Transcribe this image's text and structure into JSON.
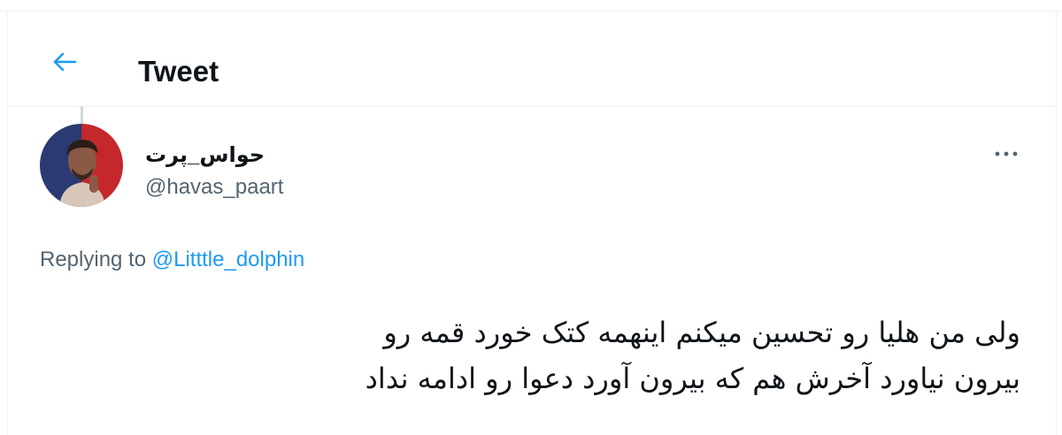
{
  "header": {
    "title": "Tweet",
    "back_icon": "arrow-left-icon"
  },
  "tweet": {
    "author": {
      "display_name": "حواس_پرت",
      "username": "@havas_paart",
      "avatar_icon": "avatar-photo"
    },
    "more_icon": "more-horizontal-icon",
    "reply": {
      "prefix": "Replying to",
      "mention": "@Litttle_dolphin"
    },
    "text_lines": [
      "ولی من هلیا رو تحسین میکنم اینهمه کتک خورد قمه رو",
      "بیرون نیاورد آخرش هم که بیرون آورد دعوا رو ادامه نداد"
    ]
  },
  "colors": {
    "accent": "#1d9bf0",
    "text_primary": "#0f1419",
    "text_secondary": "#536471",
    "border": "#eef0f2"
  }
}
